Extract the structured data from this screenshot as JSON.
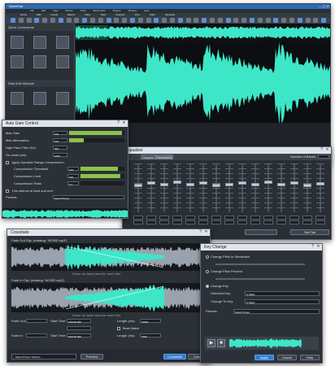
{
  "main_window": {
    "title": "WavePad",
    "menu": [
      "File",
      "Edit",
      "View",
      "Effects",
      "Tools",
      "Bookmarks",
      "Plugins",
      "Window",
      "Help"
    ],
    "tabs": [
      "Home",
      "Edit",
      "Levels",
      "Effects",
      "Voice",
      "Tools",
      "Analysis",
      "View",
      "Suite",
      "Favorites"
    ],
    "left_panel_title": "Quick Commands",
    "left_panel_title_2": "Start Edit Wizards",
    "wave_color": "#3ee6c8"
  },
  "auto_gain": {
    "title": "Auto Gain Control",
    "rows": [
      {
        "label": "Max Gain",
        "value": "100",
        "fill": 0.95
      },
      {
        "label": "Max Attenuation",
        "value": "100",
        "fill": 0.26
      }
    ],
    "high_pass_label": "High Pass Filter (Hz)",
    "high_pass_value": "400",
    "on_onset_label": "On onset (ms)",
    "on_onset_value": "1000",
    "apply_label": "Apply Dynamic Range Compression",
    "compression_rows": [
      {
        "label": "Compression Threshold",
        "value": "100",
        "fill": 0.85
      },
      {
        "label": "Compression Limit",
        "value": "100",
        "fill": 0.9
      },
      {
        "label": "Compression Ratio",
        "value": "2:1",
        "fill": 0.0
      }
    ],
    "trim_label": "Trim silence at start and end",
    "preset_label": "Presets",
    "preset_value": "Select Preset"
  },
  "equalizer": {
    "title": "Equalizer",
    "tabs": [
      "Graphic",
      "Parametric"
    ],
    "tab_active": "Parametric",
    "num_bands_label": "Number of Bands",
    "button_label": "Set Flat",
    "slider_levels": [
      0.55,
      0.6,
      0.58,
      0.62,
      0.57,
      0.6,
      0.55,
      0.58,
      0.6,
      0.57,
      0.62,
      0.58,
      0.6,
      0.56,
      0.59
    ]
  },
  "crossfade": {
    "title": "Crossfade",
    "track1_label": "Fade Out Clip: (missing: 'NOISE.mp3')",
    "track2_label": "Fade In Clip: (missing: 'NOISE.mp3')",
    "hint": "Hover on wave area for more info",
    "fields_row1": [
      {
        "label": "Fade Out:",
        "value": ""
      },
      {
        "label": "Start Time:",
        "value": "0:00:00.000"
      },
      {
        "label": "Length (ms):",
        "value": "10000"
      }
    ],
    "fields_row2": [
      {
        "label": "Fade In:",
        "value": ""
      },
      {
        "label": "Start Time:",
        "value": "0:00:00.000"
      },
      {
        "label": "Length (ms):",
        "value": "7000"
      }
    ],
    "beat_match_label": "Beat Match",
    "preset_select": "-- Select Preset / Actions --",
    "buttons": [
      "Preview",
      "Crossfade",
      "Cancel"
    ]
  },
  "key_change": {
    "title": "Key Change",
    "option1": "Change Pitch in Semitones",
    "option2": "Change Pitch Percent",
    "option3": "Change Key",
    "detected_key_label": "Detected Key:",
    "detected_key_value": "G Major",
    "change_to_label": "Change To Key:",
    "change_to_value": "G Major",
    "presets_label": "Presets:",
    "presets_value": "Select Preset",
    "buttons": [
      "Apply",
      "Cancel",
      "Help"
    ]
  }
}
